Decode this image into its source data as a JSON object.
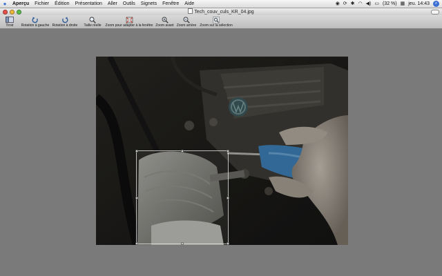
{
  "menubar": {
    "app_name": "Aperçu",
    "items": [
      "Fichier",
      "Édition",
      "Présentation",
      "Aller",
      "Outils",
      "Signets",
      "Fenêtre",
      "Aide"
    ],
    "battery_text": "(32 %)",
    "clock": "jeu. 14:43"
  },
  "window": {
    "title": "Tech_couv_culs_KR_04.jpg"
  },
  "toolbar": {
    "drawer": "Tiroir",
    "rotate_left": "Rotation à gauche",
    "rotate_right": "Rotation à droite",
    "actual_size": "Taille réelle",
    "zoom_to_fit": "Zoom pour adapter à la fenêtre",
    "zoom_in": "Zoom avant",
    "zoom_out": "Zoom arrière",
    "zoom_to_selection": "Zoom sur la sélection"
  },
  "colors": {
    "content_bg": "#7a7a7a",
    "close": "#e8504a",
    "minimize": "#f0b83a",
    "zoom": "#5cbf4a",
    "screwdriver_handle": "#3e7fb6"
  }
}
